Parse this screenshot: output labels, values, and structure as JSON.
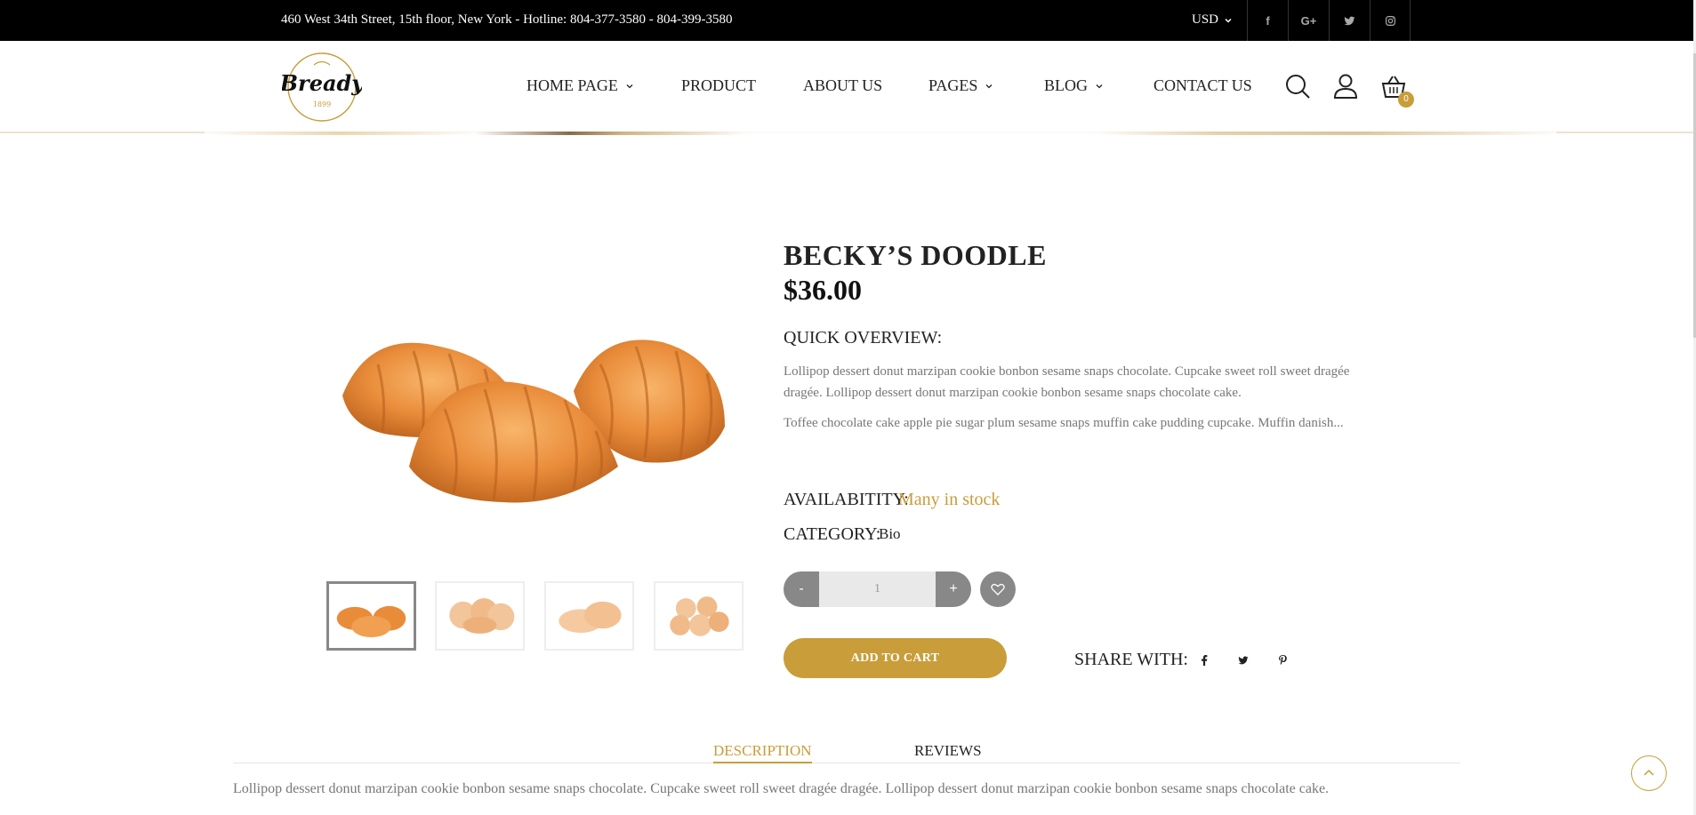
{
  "topbar": {
    "address": "460 West 34th Street, 15th floor, New York - Hotline: 804-377-3580 - 804-399-3580",
    "currency": "USD",
    "socials": [
      {
        "icon": "facebook-icon",
        "glyph": "f"
      },
      {
        "icon": "google-plus-icon",
        "glyph": "G+"
      },
      {
        "icon": "twitter-icon",
        "glyph": "t"
      },
      {
        "icon": "instagram-icon",
        "glyph": "◎"
      }
    ]
  },
  "header": {
    "logo_text": "Bready",
    "logo_year": "1899",
    "nav": [
      {
        "label": "HOME PAGE",
        "dropdown": true
      },
      {
        "label": "PRODUCT",
        "dropdown": false
      },
      {
        "label": "ABOUT US",
        "dropdown": false
      },
      {
        "label": "PAGES",
        "dropdown": true
      },
      {
        "label": "BLOG",
        "dropdown": true
      },
      {
        "label": "CONTACT US",
        "dropdown": false
      }
    ],
    "cart_count": "0"
  },
  "product": {
    "title": "BECKY’S DOODLE",
    "price": "$36.00",
    "overview_label": "QUICK OVERVIEW:",
    "overview_p1": "Lollipop dessert donut marzipan cookie bonbon sesame snaps chocolate. Cupcake sweet roll sweet dragée dragée. Lollipop dessert donut marzipan cookie bonbon sesame snaps chocolate cake.",
    "overview_p2": "Toffee chocolate cake apple pie sugar plum sesame snaps muffin cake pudding cupcake. Muffin danish...",
    "availability_label": "AVAILABITITY:",
    "availability_value": "Many in stock",
    "category_label": "CATEGORY:",
    "category_value": "Bio",
    "qty_minus": "-",
    "qty_plus": "+",
    "qty_value": "1",
    "add_to_cart": "ADD TO CART",
    "share_label": "SHARE WITH:"
  },
  "tabs": {
    "description": "DESCRIPTION",
    "reviews": "REVIEWS",
    "body": "Lollipop dessert donut marzipan cookie bonbon sesame snaps chocolate. Cupcake sweet roll sweet dragée dragée. Lollipop dessert donut marzipan cookie bonbon sesame snaps chocolate cake."
  },
  "colors": {
    "accent": "#c89d3a",
    "topbar_bg": "#000000",
    "button_gray": "#888888"
  }
}
